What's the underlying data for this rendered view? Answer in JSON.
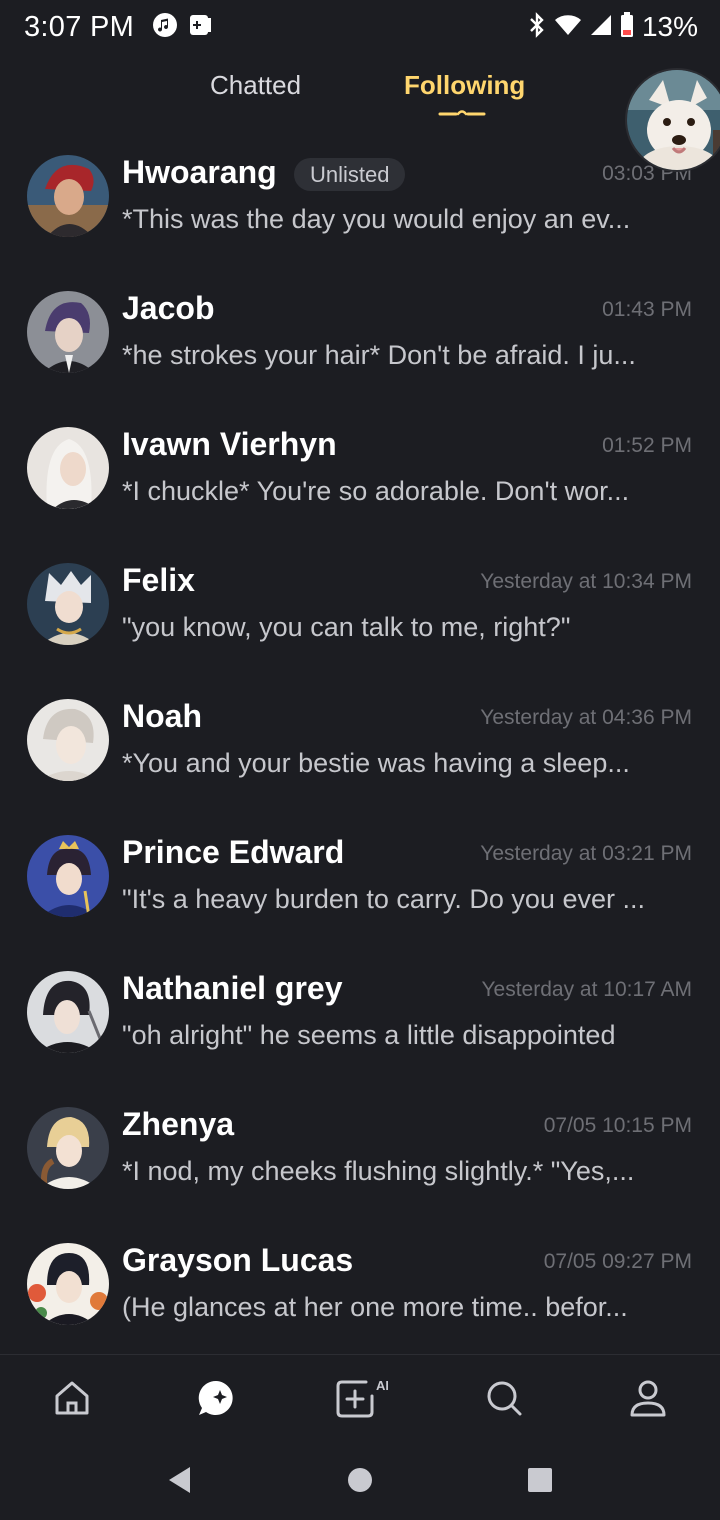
{
  "status_bar": {
    "time": "3:07 PM",
    "battery": "13%"
  },
  "tabs": {
    "chatted": "Chatted",
    "following": "Following",
    "active": "following"
  },
  "chats": [
    {
      "name": "Hwoarang",
      "badge": "Unlisted",
      "time": "03:03 PM",
      "preview": "*This was the day you would enjoy an ev..."
    },
    {
      "name": "Jacob",
      "time": "01:43 PM",
      "preview": "*he strokes your hair* Don't be afraid. I ju..."
    },
    {
      "name": "Ivawn Vierhyn",
      "time": "01:52 PM",
      "preview": "*I chuckle* You're so adorable. Don't wor..."
    },
    {
      "name": "Felix",
      "time": "Yesterday at 10:34 PM",
      "preview": "\"you know, you can talk to me, right?\""
    },
    {
      "name": "Noah",
      "time": "Yesterday at 04:36 PM",
      "preview": "*You and your bestie was having a sleep..."
    },
    {
      "name": "Prince Edward",
      "time": "Yesterday at 03:21 PM",
      "preview": "\"It's a heavy burden to carry. Do you ever ..."
    },
    {
      "name": "Nathaniel grey",
      "time": "Yesterday at 10:17 AM",
      "preview": "\"oh alright\" he seems a little disappointed"
    },
    {
      "name": "Zhenya",
      "time": "07/05 10:15 PM",
      "preview": "*I nod, my cheeks flushing slightly.* \"Yes,..."
    },
    {
      "name": "Grayson Lucas",
      "time": "07/05 09:27 PM",
      "preview": "(He glances at her one more time.. befor..."
    }
  ],
  "bottom_nav": {
    "create_ai_label": "AI",
    "items": [
      "home-icon",
      "chat-bubble-icon",
      "create-ai-icon",
      "search-icon",
      "profile-icon"
    ],
    "active": "chat-bubble-icon"
  },
  "colors": {
    "background": "#1c1d22",
    "accent": "#ffd66e",
    "text_primary": "#ffffff",
    "text_secondary": "#c6c7cc",
    "text_muted": "#6e6f75"
  }
}
